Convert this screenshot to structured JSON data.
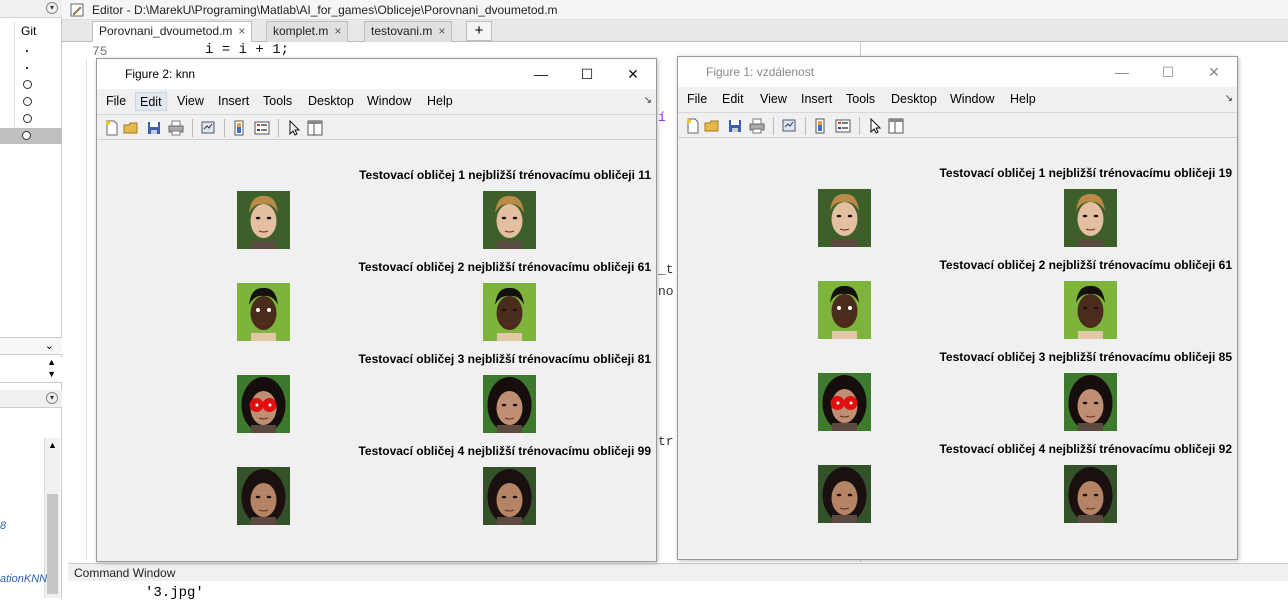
{
  "editor": {
    "title": "Editor - D:\\MarekU\\Programing\\Matlab\\AI_for_games\\Obliceje\\Porovnani_dvoumetod.m",
    "tabs": [
      {
        "label": "Porovnani_dvoumetod.m",
        "close": "×"
      },
      {
        "label": "komplet.m",
        "close": "×"
      },
      {
        "label": "testovani.m",
        "close": "×"
      }
    ],
    "add_tab": "+",
    "line_number": "75",
    "code_line": "i = i + 1;",
    "fragments": [
      "í",
      "_t",
      "no",
      "tr"
    ]
  },
  "left_panel": {
    "git_label": "Git",
    "fragment_8": "8",
    "fragment_ation": "ationKNN"
  },
  "command_window": {
    "title": "Command Window",
    "text": "'3.jpg'"
  },
  "colors": {
    "skin_green": "#6fa83a",
    "dark_green": "#2f5a22",
    "red_mark": "#e01010",
    "figure_bg": "#f0f0f0"
  },
  "figures": [
    {
      "id": "knn",
      "title": "Figure 2: knn",
      "active": true,
      "menus": [
        "File",
        "Edit",
        "View",
        "Insert",
        "Tools",
        "Desktop",
        "Window",
        "Help"
      ],
      "highlighted_menu": "Edit",
      "dock_glyph": "↘",
      "window_buttons": {
        "minimize": "—",
        "maximize": "☐",
        "close": "✕"
      },
      "rows": [
        {
          "caption": "Testovací obličej 1 nejbližší trénovacímu obličeji 11",
          "test_face": "blond-man",
          "train_face": "blond-man"
        },
        {
          "caption": "Testovací obličej 2 nejbližší trénovacímu obličeji 61",
          "test_face": "dark-man-marked",
          "train_face": "dark-man"
        },
        {
          "caption": "Testovací obličej 3 nejbližší trénovacímu obličeji 81",
          "test_face": "woman-red-eyes",
          "train_face": "woman"
        },
        {
          "caption": "Testovací obličej 4 nejbližší trénovacímu obličeji 99",
          "test_face": "curly-woman",
          "train_face": "curly-woman"
        }
      ]
    },
    {
      "id": "vzdalenost",
      "title": "Figure 1: vzdálenost",
      "active": false,
      "menus": [
        "File",
        "Edit",
        "View",
        "Insert",
        "Tools",
        "Desktop",
        "Window",
        "Help"
      ],
      "highlighted_menu": "",
      "dock_glyph": "↘",
      "window_buttons": {
        "minimize": "—",
        "maximize": "☐",
        "close": "✕"
      },
      "rows": [
        {
          "caption": "Testovací obličej 1 nejbližší trénovacímu obličeji 19",
          "test_face": "blond-man",
          "train_face": "blond-man"
        },
        {
          "caption": "Testovací obličej 2 nejbližší trénovacímu obličeji 61",
          "test_face": "dark-man-marked",
          "train_face": "dark-man"
        },
        {
          "caption": "Testovací obličej 3 nejbližší trénovacímu obličeji 85",
          "test_face": "woman-red-eyes",
          "train_face": "woman"
        },
        {
          "caption": "Testovací obličej 4 nejbližší trénovacímu obličeji 92",
          "test_face": "curly-woman",
          "train_face": "curly-woman"
        }
      ]
    }
  ]
}
